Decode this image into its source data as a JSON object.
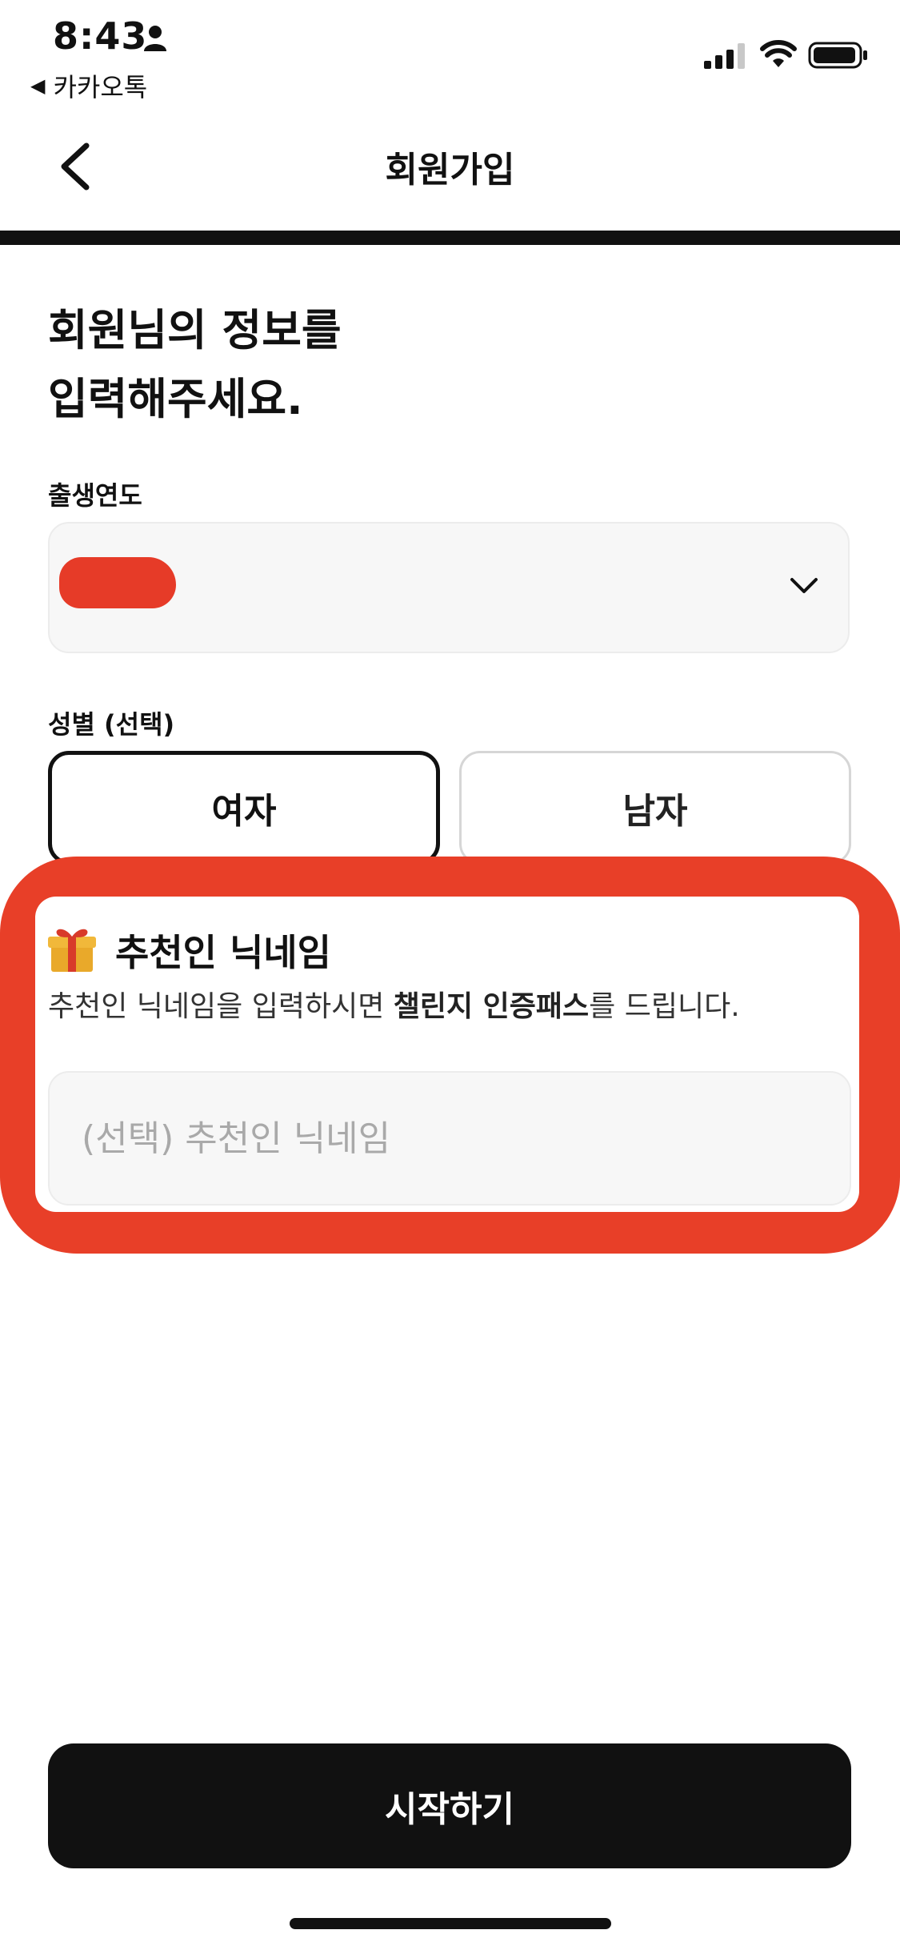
{
  "status_bar": {
    "time": "8:43",
    "back_app": "카카오톡"
  },
  "nav": {
    "title": "회원가입"
  },
  "heading": {
    "line1": "회원님의 정보를",
    "line2": "입력해주세요."
  },
  "birth_year": {
    "label": "출생연도"
  },
  "gender": {
    "label": "성별 (선택)",
    "female": "여자",
    "male": "남자",
    "selected": "여자"
  },
  "referral": {
    "title": "추천인 닉네임",
    "desc_prefix": "추천인 닉네임을 입력하시면 ",
    "desc_bold": "챌린지 인증패스",
    "desc_suffix": "를 드립니다.",
    "placeholder": "(선택) 추천인 닉네임",
    "highlight_color": "#e83f28"
  },
  "start_button": {
    "label": "시작하기"
  },
  "colors": {
    "primary": "#111111",
    "background": "#ffffff",
    "field_bg": "#f7f7f7"
  }
}
